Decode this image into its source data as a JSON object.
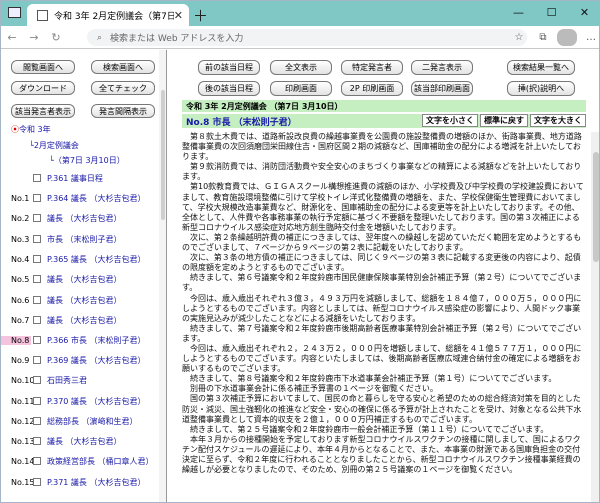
{
  "browser": {
    "tab_title": "令和 3年 2月定例議会（第7日 3月10日）",
    "address_placeholder": "検索または Web アドレスを入力"
  },
  "left_buttons": [
    "閲覧画面へ",
    "検索画面へ",
    "ダウンロード",
    "全てチェック",
    "該当発言者表示",
    "発言間隔表示"
  ],
  "tree": {
    "year": "令和 3年",
    "session": "2月定例議会",
    "day": "（第7日 3月10日）"
  },
  "rows": [
    {
      "no": "",
      "label": "P.361 議事日程"
    },
    {
      "no": "No.1",
      "label": "P.364 議長 （大杉吉包君）"
    },
    {
      "no": "No.2",
      "label": "議長 （大杉吉包君）"
    },
    {
      "no": "No.3",
      "label": "市長 （末松則子君）"
    },
    {
      "no": "No.4",
      "label": "P.365 議長 （大杉吉包君）"
    },
    {
      "no": "No.5",
      "label": "議長 （大杉吉包君）"
    },
    {
      "no": "No.6",
      "label": "議長 （大杉吉包君）"
    },
    {
      "no": "No.7",
      "label": "議長 （大杉吉包君）"
    },
    {
      "no": "No.8",
      "label": "P.366 市長 （末松則子君）"
    },
    {
      "no": "No.9",
      "label": "P.369 議長 （大杉吉包君）"
    },
    {
      "no": "No.10",
      "label": "石田秀三君"
    },
    {
      "no": "No.11",
      "label": "P.370 議長 （大杉吉包君）"
    },
    {
      "no": "No.12",
      "label": "総務部長 （濵﨑和生君）"
    },
    {
      "no": "No.13",
      "label": "議長 （大杉吉包君）"
    },
    {
      "no": "No.14",
      "label": "政策経営部長 （桶口章人君）"
    },
    {
      "no": "No.15",
      "label": "P.371 議長 （大杉吉包君）"
    }
  ],
  "main_buttons": [
    "前の該当日程",
    "全文表示",
    "特定発言者",
    "二発言表示",
    "検索結果一覧へ",
    "後の該当日程",
    "印刷画面",
    "2P 印刷画面",
    "該当部印刷画面",
    "挿(択)説明へ"
  ],
  "title_bar": "令和 3年 2月定例議会 （第7日 3月10日）",
  "speaker_bar": "No.8 市長 （末松則子君）",
  "font_buttons": [
    "文字を小さく",
    "標準に戻す",
    "文字を大きく"
  ],
  "body_paragraphs": [
    "第８款土木費では、道路新設改良費の繰越事業費を公園費の施設整備費の増額のほか、街路事業費、地方道路整備事業費の次回須磨団栄田線住吉・国府区間２期の減額など、国庫補助金の配分による増減を計上いたしております。",
    "第９款消防費では、消防団活動費や安全安心のまちづくり事業などの精算による減額などを計上いたしております。",
    "第10款教育費では、ＧＩＧＡスクール構想推進費の減額のほか、小学校費及び中学校費の学校建設費においてまして、教育施設環境整備に引けて学校トイレ洋式化整備費の増額を、また、学校保健衛生管理費においてまして、学校大規模改造事業費など、財源化を、国庫補助金の配分による変更等を計上いたしております。その他、全体として、人件費や各事務事業の執行予定額に基づく不要額を整理いたしております。国の第３次補正による新型コロナウイルス感染症対応地方創生臨時交付金を増額いたしております。",
    "次に、第２条繰越明許費の補正につきましては、翌年度への繰越しを認めていただく範囲を定めようとするものでございまして、７ページから９ページの第２表に記載をいたしております。",
    "次に、第３条の地方債の補正につきましては、同じく９ページの第３表に記載する変更後の内容により、起債の限度額を定めようとするものでございます。",
    "続きまして、第６号議案令和２年度鈴鹿市国民健康保険事業特別会計補正予算（第２号）についてでございます。",
    "今回は、歳入歳出それぞれ３億３，４９３万円を減額しまして、総額を１８４億７，０００万５，０００円にしようとするものでございます。内容としましては、新型コロナウイルス感染症の影響により、人間ドック事業の実施見込みが減少したことなどによる減額をいたしております。",
    "続きまして、第７号議案令和２年度鈴鹿市後期高齢者医療事業特別会計補正予算（第２号）についてでございます。",
    "今回は、歳入歳出それぞれ２，２４３万２，０００円を増額しまして、総額を４１億５７７万１，０００円にしようとするものでございます。内容といたしましては、後期高齢者医療広域連合納付金の確定による増額をお願いするものでございます。",
    "続きまして、第８号議案令和２年度鈴鹿市下水道事業会計補正予算（第１号）についてでございます。",
    "別冊の下水道事業会計に係る補正予算書の１ページを御覧ください。",
    "国の第３次補正予算においてまして、国民の命と暮らしを守る安心と希望のための総合経済対策を目的とした防災・減災、国土強靭化の推進など安全・安心の確保に係る予算が計上されたことを受け、対象となる公共下水道整備事業費として資本的収支を２億１，０００万円補正するものでございます。",
    "続きまして、第２５号議案令和２年度鈴鹿市一般会計補正予算（第１１号）についてでございます。",
    "本年３月からの接種開始を予定しております新型コロナウイルスワクチンの接種に関しまして、国によるワクチン配付スケジュールの遅延により、本年４月からとなることで、また、本事業の財源である国庫負担金の交付決定に至らず、令和２年度に行われることとなりましたことから、新型コロナウイルスワクチン接種事業経費の繰越しが必要となりましたので、そのため、別冊の第２５号議案の１ページを御覧ください。"
  ]
}
